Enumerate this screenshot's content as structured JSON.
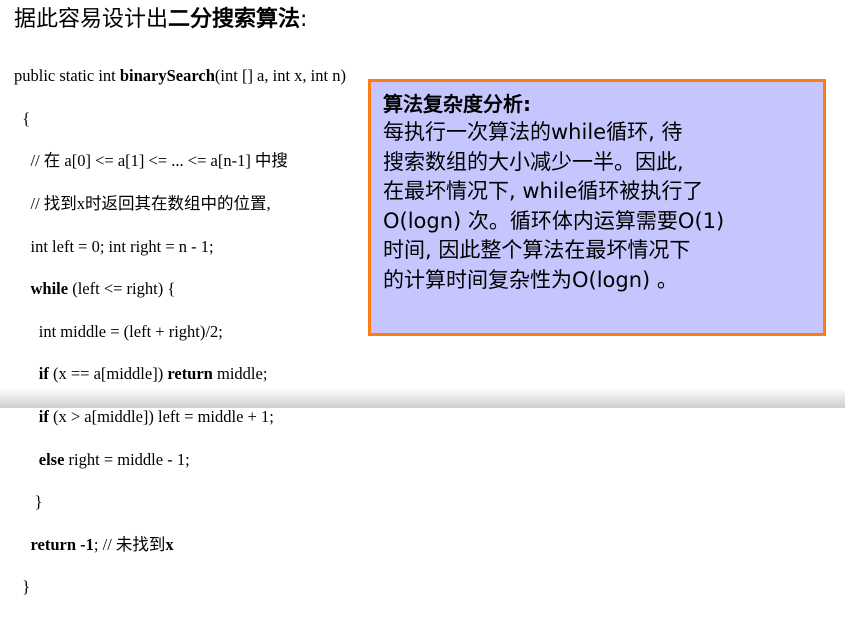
{
  "heading": {
    "prefix": "据此容易设计出",
    "emphasis": "二分搜索算法",
    "suffix": ":"
  },
  "code": {
    "signature": {
      "pre": "public static int ",
      "fn": "binarySearch",
      "post": "(int [] a, int x, int n)"
    },
    "open_brace": "{",
    "comment1": "// 在 a[0] <= a[1] <= ... <= a[n-1] 中搜",
    "comment2": "// 找到x时返回其在数组中的位置,",
    "decl": "int left = 0; int right = n - 1;",
    "while_kw": "while",
    "while_rest": " (left <= right) {",
    "middle": "int middle = (left + right)/2;",
    "if1_kw": "if",
    "if1_mid": " (x == a[middle]) ",
    "return_kw": "return",
    "if1_end": " middle;",
    "if2_kw": "if",
    "if2_rest": " (x > a[middle]) left = middle + 1;",
    "else_kw": "else",
    "else_rest": " right = middle - 1;",
    "inner_close": "}",
    "ret2_kw": "return",
    "ret2_val": " -1",
    "ret2_comment": "; // 未找到",
    "ret2_x": "x",
    "close_brace": "}"
  },
  "analysis": {
    "title": "算法复杂度分析:",
    "lines": [
      "每执行一次算法的while循环, 待",
      "搜索数组的大小减少一半。因此,",
      "在最坏情况下, while循环被执行了",
      "O(logn) 次。循环体内运算需要O(1)",
      "时间, 因此整个算法在最坏情况下",
      "的计算时间复杂性为O(logn) 。"
    ]
  }
}
